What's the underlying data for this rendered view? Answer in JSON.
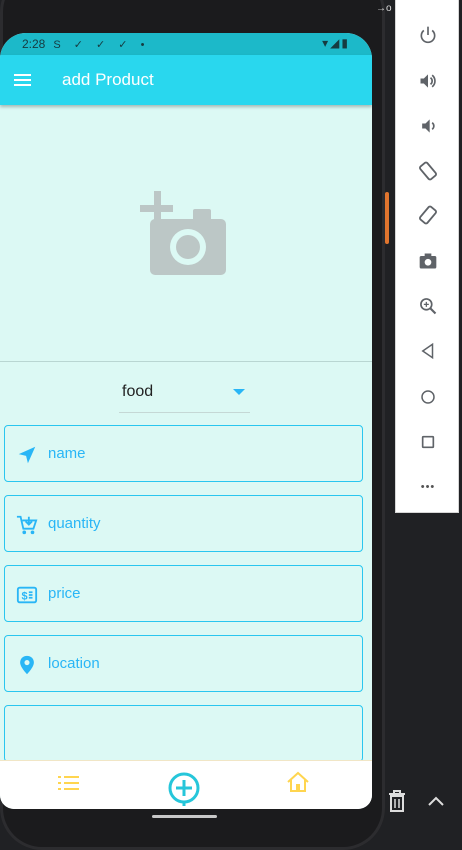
{
  "status_bar": {
    "time": "2:28",
    "left_icons": "S ✓ ✓ ✓ •",
    "right_icons": "▾◢▮"
  },
  "app_bar": {
    "title": "add Product"
  },
  "image_picker": {
    "icon": "add-a-photo-icon"
  },
  "category_dropdown": {
    "selected": "food"
  },
  "form": {
    "fields": [
      {
        "label": "name",
        "icon": "navigation-arrow-icon"
      },
      {
        "label": "quantity",
        "icon": "cart-icon"
      },
      {
        "label": "price",
        "icon": "money-icon"
      },
      {
        "label": "location",
        "icon": "location-pin-icon"
      },
      {
        "label": "",
        "icon": ""
      }
    ]
  },
  "bottom_nav": {
    "items": [
      {
        "icon": "list-icon"
      },
      {
        "icon": "add-circle-icon"
      },
      {
        "icon": "home-icon"
      }
    ]
  },
  "emulator_toolbar": {
    "buttons": [
      "power-icon",
      "volume-up-icon",
      "volume-down-icon",
      "rotate-left-icon",
      "rotate-right-icon",
      "screenshot-icon",
      "zoom-icon",
      "back-icon",
      "home-icon",
      "overview-icon",
      "more-icon"
    ],
    "window_controls": "– ×",
    "more_label": "•••"
  },
  "colors": {
    "app_bar": "#29d7ee",
    "status_bar": "#1cb9c9",
    "accent": "#29b6f6",
    "screen_bg": "#dcf9f4",
    "nav_icon_yellow": "#ffd54f",
    "nav_add_teal": "#26c6da"
  }
}
